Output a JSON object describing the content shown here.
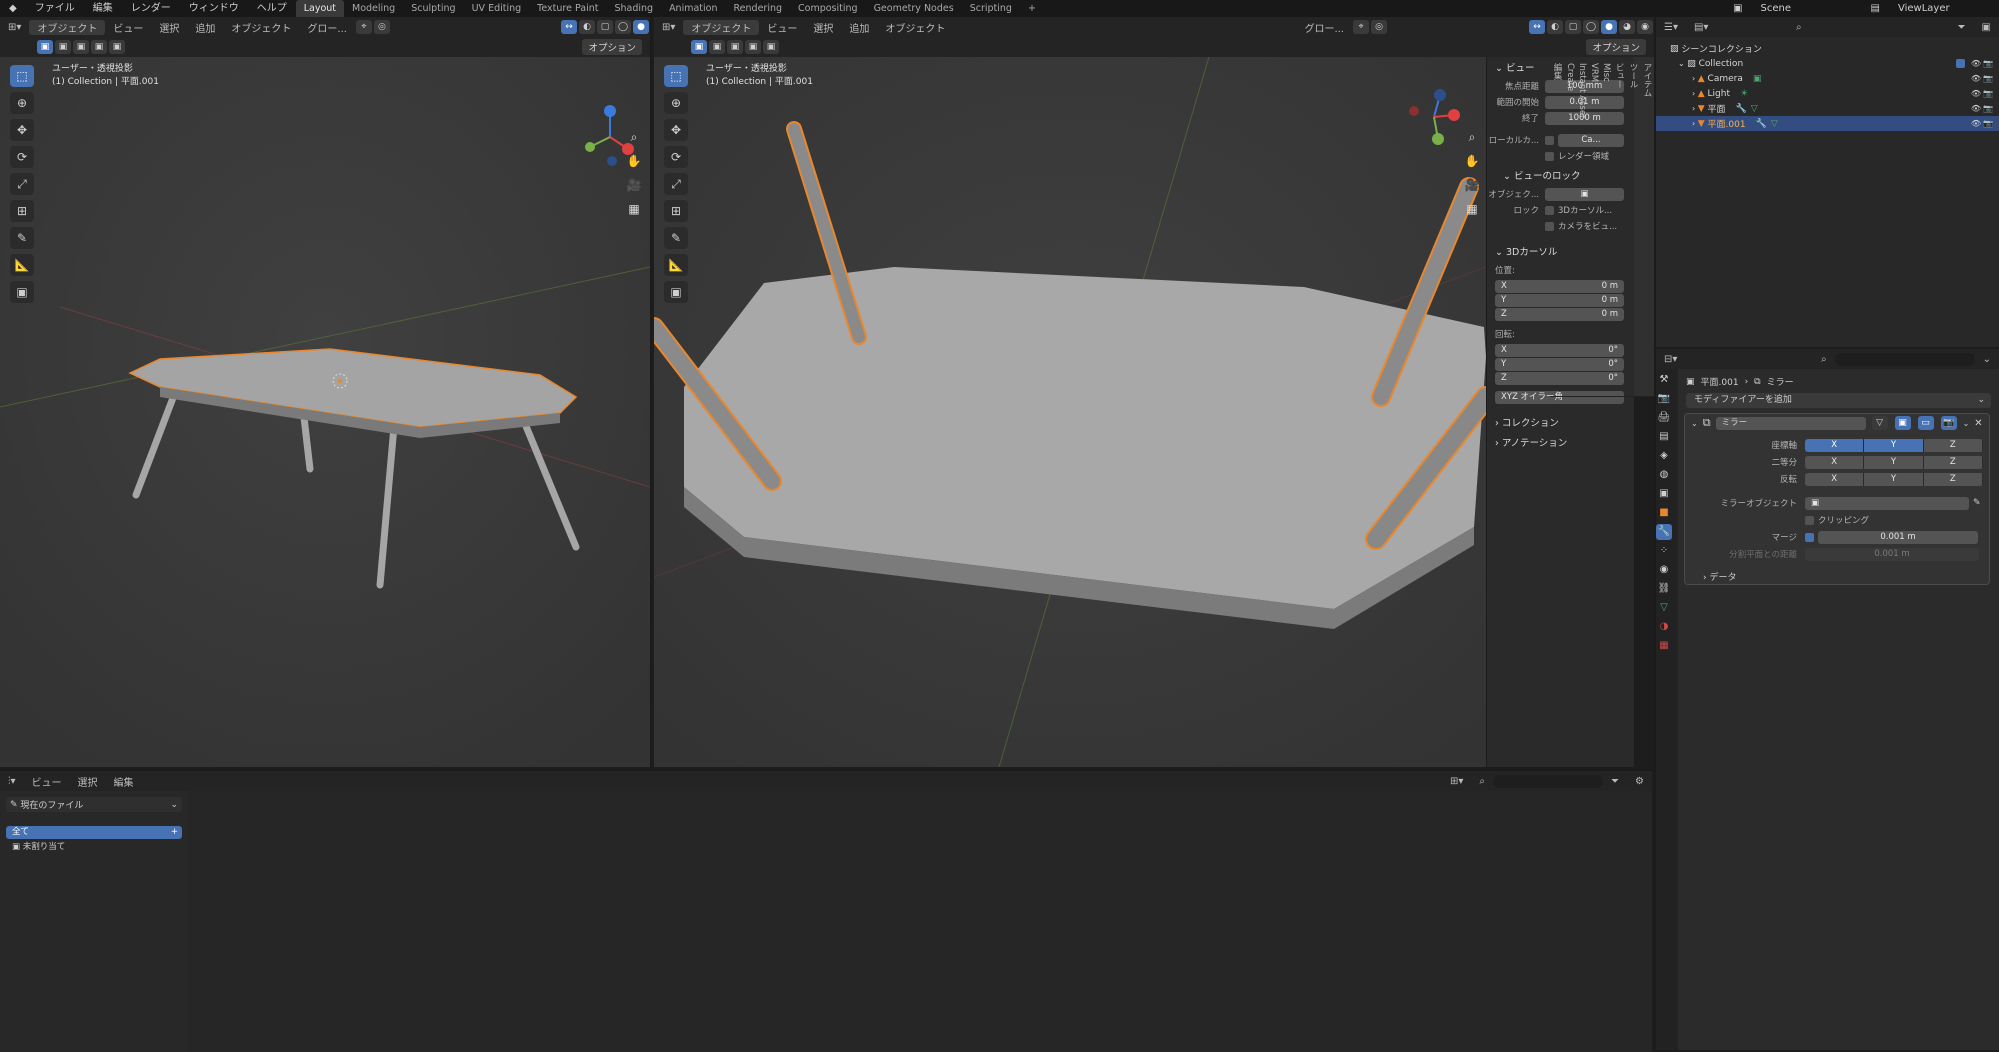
{
  "menubar": {
    "items": [
      "ファイル",
      "編集",
      "レンダー",
      "ウィンドウ",
      "ヘルプ"
    ],
    "workspaces": [
      "Layout",
      "Modeling",
      "Sculpting",
      "UV Editing",
      "Texture Paint",
      "Shading",
      "Animation",
      "Rendering",
      "Compositing",
      "Geometry Nodes",
      "Scripting"
    ],
    "active_workspace": "Layout",
    "add_tab": "+",
    "scene": "Scene",
    "view_layer": "ViewLayer"
  },
  "viewport_left": {
    "mode": "オブジェクト",
    "menus": [
      "ビュー",
      "選択",
      "追加",
      "オブジェクト"
    ],
    "orientation": "グロー...",
    "options": "オプション",
    "view_title": "ユーザー・透視投影",
    "collection_line": "(1) Collection | 平面.001"
  },
  "viewport_right": {
    "mode": "オブジェクト",
    "menus": [
      "ビュー",
      "選択",
      "追加",
      "オブジェクト"
    ],
    "orientation": "グロー...",
    "options": "オプション",
    "view_title": "ユーザー・透視投影",
    "collection_line": "(1) Collection | 平面.001"
  },
  "n_panel": {
    "view_header": "ビュー",
    "focal_label": "焦点距離",
    "focal_value": "100 mm",
    "clip_start_label": "範囲の開始",
    "clip_start_value": "0.01 m",
    "clip_end_label": "終了",
    "clip_end_value": "1000 m",
    "local_camera_label": "ローカルカ...",
    "local_camera_value": "Ca...",
    "render_region": "レンダー領域",
    "view_lock_header": "ビューのロック",
    "lock_object_label": "オブジェク...",
    "lock_label": "ロック",
    "lock_cursor": "3Dカーソル...",
    "lock_camera": "カメラをビュ...",
    "cursor_header": "3Dカーソル",
    "location_label": "位置:",
    "loc": [
      {
        "axis": "X",
        "value": "0 m"
      },
      {
        "axis": "Y",
        "value": "0 m"
      },
      {
        "axis": "Z",
        "value": "0 m"
      }
    ],
    "rotation_label": "回転:",
    "rot": [
      {
        "axis": "X",
        "value": "0°"
      },
      {
        "axis": "Y",
        "value": "0°"
      },
      {
        "axis": "Z",
        "value": "0°"
      }
    ],
    "rotation_mode": "XYZ オイラー角",
    "collection_header": "コレクション",
    "annotation_header": "アノテーション",
    "tabs": [
      "アイテム",
      "ツール",
      "ビュー",
      "Misc",
      "VRM",
      "Instant Asset",
      "Create",
      "編集"
    ]
  },
  "outliner": {
    "scene_collection": "シーンコレクション",
    "rows": [
      {
        "name": "Collection",
        "selected": false,
        "indent": 1
      },
      {
        "name": "Camera",
        "selected": false,
        "indent": 2
      },
      {
        "name": "Light",
        "selected": false,
        "indent": 2
      },
      {
        "name": "平面",
        "selected": false,
        "indent": 2
      },
      {
        "name": "平面.001",
        "selected": true,
        "indent": 2
      }
    ]
  },
  "properties": {
    "breadcrumb_object": "平面.001",
    "breadcrumb_modifier": "ミラー",
    "add_modifier": "モディファイアーを追加",
    "modifier_name": "ミラー",
    "axis_label": "座標軸",
    "bisect_label": "二等分",
    "flip_label": "反転",
    "axes": [
      "X",
      "Y",
      "Z"
    ],
    "axis_on": [
      true,
      true,
      false
    ],
    "mirror_object_label": "ミラーオブジェクト",
    "clipping_label": "クリッピング",
    "merge_label": "マージ",
    "merge_value": "0.001 m",
    "bisect_distance_label": "分割平面との距離",
    "bisect_distance_value": "0.001 m",
    "data_label": "データ"
  },
  "file_browser": {
    "menus": [
      "ビュー",
      "選択",
      "編集"
    ],
    "library": "現在のファイル",
    "items": [
      {
        "label": "全て",
        "selected": true
      },
      {
        "label": "未割り当て",
        "selected": false
      }
    ]
  },
  "colors": {
    "accent": "#4772b3",
    "selection_outline": "#e8872d",
    "viewport_bg": "#393939"
  }
}
